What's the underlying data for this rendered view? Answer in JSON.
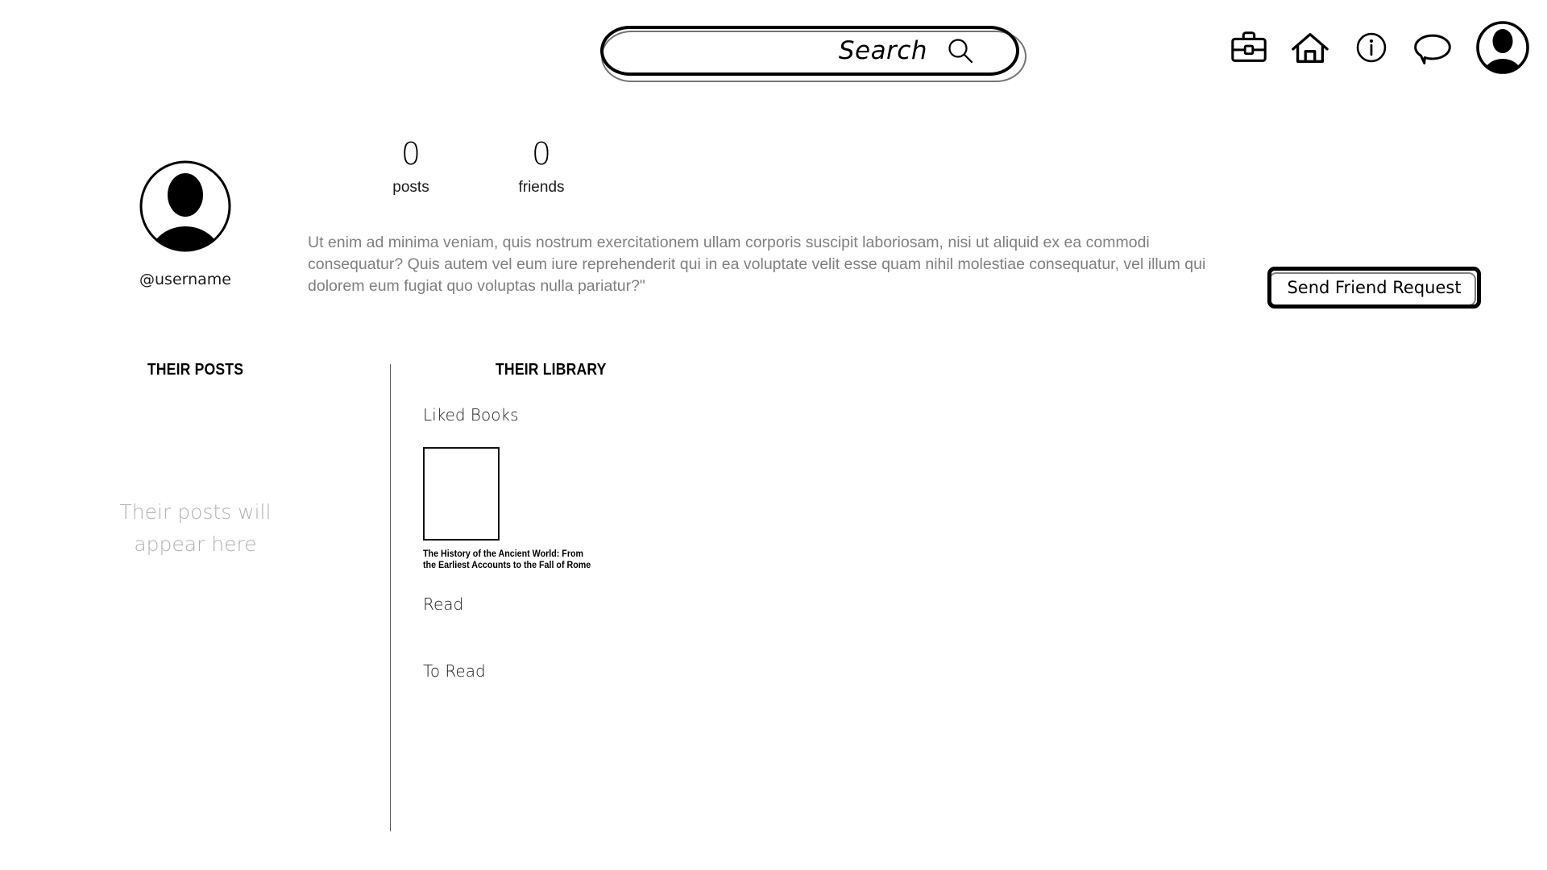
{
  "search": {
    "label": "Search",
    "placeholder": "Search",
    "icon": "search-icon",
    "value": ""
  },
  "nav": {
    "items": [
      {
        "name": "briefcase-icon",
        "label": "Briefcase"
      },
      {
        "name": "home-icon",
        "label": "Home"
      },
      {
        "name": "info-icon",
        "label": "Info"
      },
      {
        "name": "message-icon",
        "label": "Messages"
      },
      {
        "name": "account-avatar-icon",
        "label": "Account"
      }
    ]
  },
  "profile": {
    "avatar_icon": "user-avatar-icon",
    "username": "@username",
    "bio": "Ut enim ad minima veniam, quis nostrum exercitationem ullam corporis suscipit laboriosam, nisi ut aliquid ex ea commodi consequatur? Quis autem vel eum iure reprehenderit qui in ea voluptate velit esse quam nihil molestiae consequatur, vel illum qui dolorem eum fugiat quo voluptas nulla pariatur?\"",
    "stats": [
      {
        "count": "0",
        "label": "posts"
      },
      {
        "count": "0",
        "label": "friends"
      }
    ],
    "friend_request_button": "Send Friend Request"
  },
  "posts_column": {
    "heading": "THEIR POSTS",
    "empty_state_line1": "Their posts will",
    "empty_state_line2": "appear here"
  },
  "library_column": {
    "heading": "THEIR LIBRARY",
    "sections": [
      {
        "title": "Liked Books",
        "books": [
          {
            "title": "The History of the Ancient World: From the Earliest Accounts to the Fall of Rome"
          }
        ]
      },
      {
        "title": "Read",
        "books": []
      },
      {
        "title": "To Read",
        "books": []
      }
    ]
  },
  "colors": {
    "ink": "#000000",
    "muted_text": "#7f7f7f",
    "placeholder_text": "#b0b0b0",
    "divider": "#58595b",
    "background": "#ffffff"
  }
}
